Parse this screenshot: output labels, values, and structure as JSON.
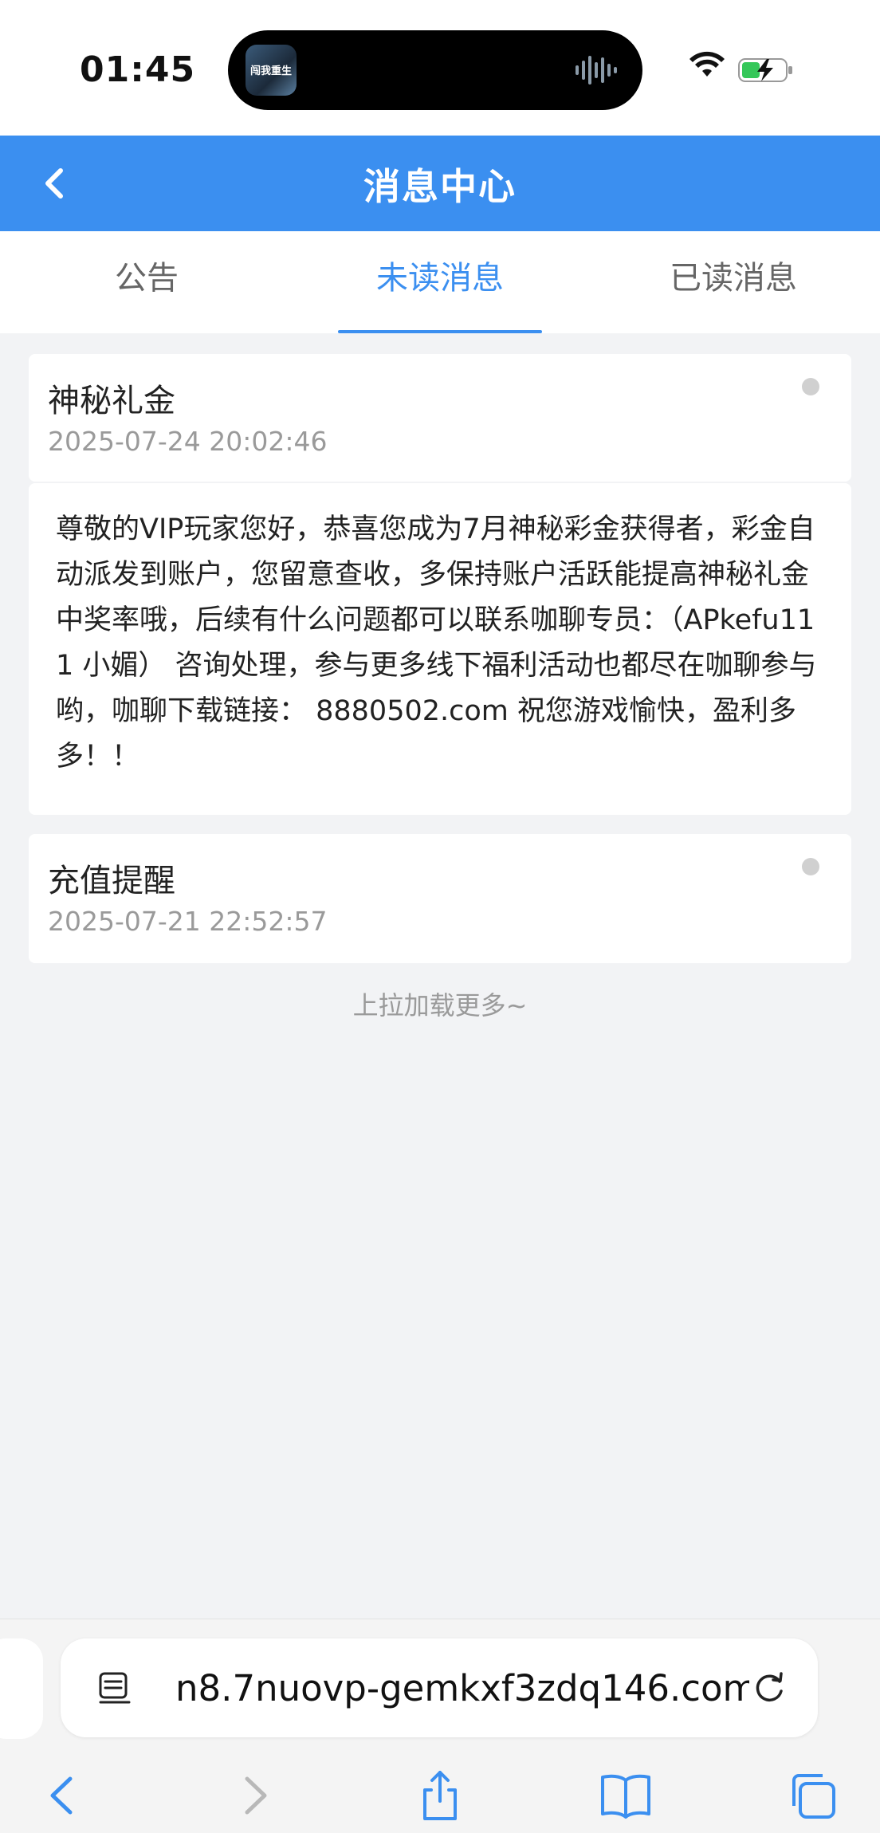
{
  "status_bar": {
    "time": "01:45",
    "app_icon_text": "闯我重生"
  },
  "header": {
    "title": "消息中心"
  },
  "tabs": [
    {
      "label": "公告",
      "active": false
    },
    {
      "label": "未读消息",
      "active": true
    },
    {
      "label": "已读消息",
      "active": false
    }
  ],
  "messages": [
    {
      "title": "神秘礼金",
      "date": "2025-07-24 20:02:46",
      "content": "尊敬的VIP玩家您好，恭喜您成为7月神秘彩金获得者，彩金自动派发到账户，您留意查收，多保持账户活跃能提高神秘礼金中奖率哦，后续有什么问题都可以联系咖聊专员：（APkefu111  小媚） 咨询处理，参与更多线下福利活动也都尽在咖聊参与哟，咖聊下载链接： 8880502.com 祝您游戏愉快，盈利多多！！"
    },
    {
      "title": "充值提醒",
      "date": "2025-07-21 22:52:57"
    }
  ],
  "load_more": "上拉加载更多~",
  "browser": {
    "url": "n8.7nuovp-gemkxf3zdq146.com"
  },
  "colors": {
    "accent": "#3b8ff0",
    "unread_dot": "#d0d0d0"
  }
}
